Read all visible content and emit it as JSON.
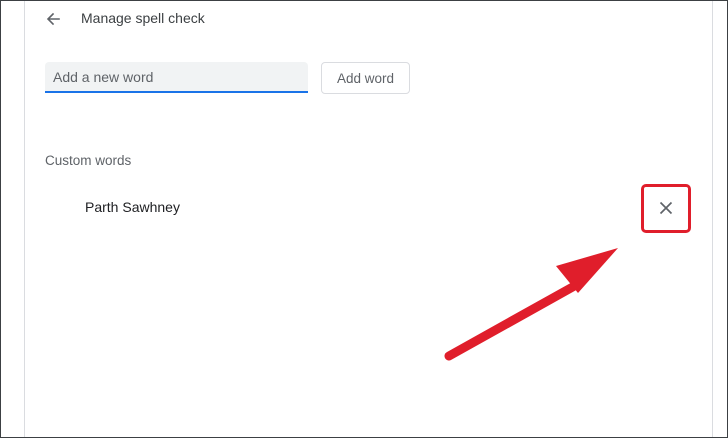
{
  "header": {
    "back_icon": "arrow-left-icon",
    "title": "Manage spell check"
  },
  "add_word": {
    "input_placeholder": "Add a new word",
    "input_value": "",
    "button_label": "Add word"
  },
  "custom_words": {
    "heading": "Custom words",
    "items": [
      {
        "word": "Parth Sawhney",
        "remove_icon": "close-icon"
      }
    ]
  },
  "annotation": {
    "type": "arrow-and-box",
    "color": "#e01e2b",
    "target": "remove-word-button"
  },
  "colors": {
    "accent": "#1a73e8",
    "annotation": "#e01e2b"
  }
}
